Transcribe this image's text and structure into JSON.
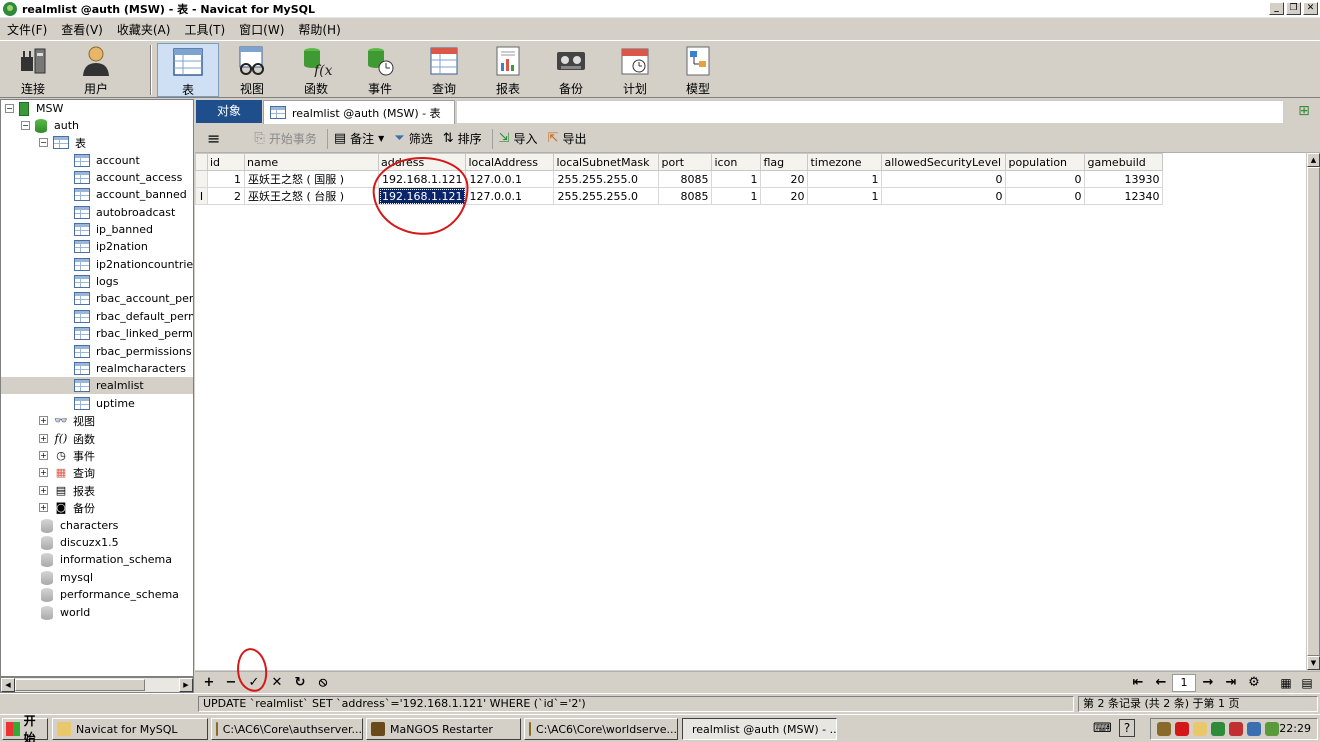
{
  "window": {
    "title": "realmlist @auth (MSW) - 表 - Navicat for MySQL",
    "min": "_",
    "restore": "❐",
    "close": "✕"
  },
  "menu": [
    "文件(F)",
    "查看(V)",
    "收藏夹(A)",
    "工具(T)",
    "窗口(W)",
    "帮助(H)"
  ],
  "toolbar": {
    "connect": "连接",
    "user": "用户",
    "table": "表",
    "view": "视图",
    "function": "函数",
    "event": "事件",
    "query": "查询",
    "report": "报表",
    "backup": "备份",
    "schedule": "计划",
    "model": "模型"
  },
  "tree": {
    "connection": "MSW",
    "db_auth": "auth",
    "tables_label": "表",
    "tables": [
      "account",
      "account_access",
      "account_banned",
      "autobroadcast",
      "ip_banned",
      "ip2nation",
      "ip2nationcountries",
      "logs",
      "rbac_account_permis",
      "rbac_default_permiss",
      "rbac_linked_permissic",
      "rbac_permissions",
      "realmcharacters",
      "realmlist",
      "uptime"
    ],
    "selected_table": "realmlist",
    "groups": [
      "视图",
      "函数",
      "事件",
      "查询",
      "报表",
      "备份"
    ],
    "other_dbs": [
      "characters",
      "discuzx1.5",
      "information_schema",
      "mysql",
      "performance_schema",
      "world"
    ]
  },
  "tabs": {
    "objects": "对象",
    "table_tab": "realmlist @auth (MSW) - 表"
  },
  "gridtoolbar": {
    "menu": "≡",
    "begin_tx": "开始事务",
    "memo": "备注",
    "filter": "筛选",
    "sort": "排序",
    "import": "导入",
    "export": "导出"
  },
  "grid": {
    "columns": [
      "id",
      "name",
      "address",
      "localAddress",
      "localSubnetMask",
      "port",
      "icon",
      "flag",
      "timezone",
      "allowedSecurityLevel",
      "population",
      "gamebuild"
    ],
    "rows": [
      [
        "1",
        "巫妖王之怒 ( 国服 )",
        "192.168.1.121",
        "127.0.0.1",
        "255.255.255.0",
        "8085",
        "1",
        "20",
        "1",
        "0",
        "0",
        "13930"
      ],
      [
        "2",
        "巫妖王之怒 ( 台服 )",
        "192.168.1.121",
        "127.0.0.1",
        "255.255.255.0",
        "8085",
        "1",
        "20",
        "1",
        "0",
        "0",
        "12340"
      ]
    ],
    "row2_marker": "I"
  },
  "navbar": {
    "add": "+",
    "delete": "−",
    "apply": "✓",
    "cancel": "✕",
    "refresh": "↻",
    "stop": "⦸",
    "first": "⇤",
    "prev": "←",
    "page": "1",
    "next": "→",
    "last": "⇥",
    "settings": "⚙"
  },
  "status": {
    "sql": "UPDATE `realmlist` SET `address`='192.168.1.121' WHERE (`id`='2')",
    "records": "第 2 条记录 (共 2 条) 于第 1 页"
  },
  "taskbar": {
    "start": "开始",
    "tasks": [
      "Navicat for MySQL",
      "C:\\AC6\\Core\\authserver...",
      "MaNGOS Restarter",
      "C:\\AC6\\Core\\worldserve...",
      "realmlist @auth (MSW) - ..."
    ],
    "clock": "22:29"
  },
  "colors": {
    "accent": "#1f4e8c",
    "selection": "#0a246a",
    "annotation": "#d41818"
  }
}
